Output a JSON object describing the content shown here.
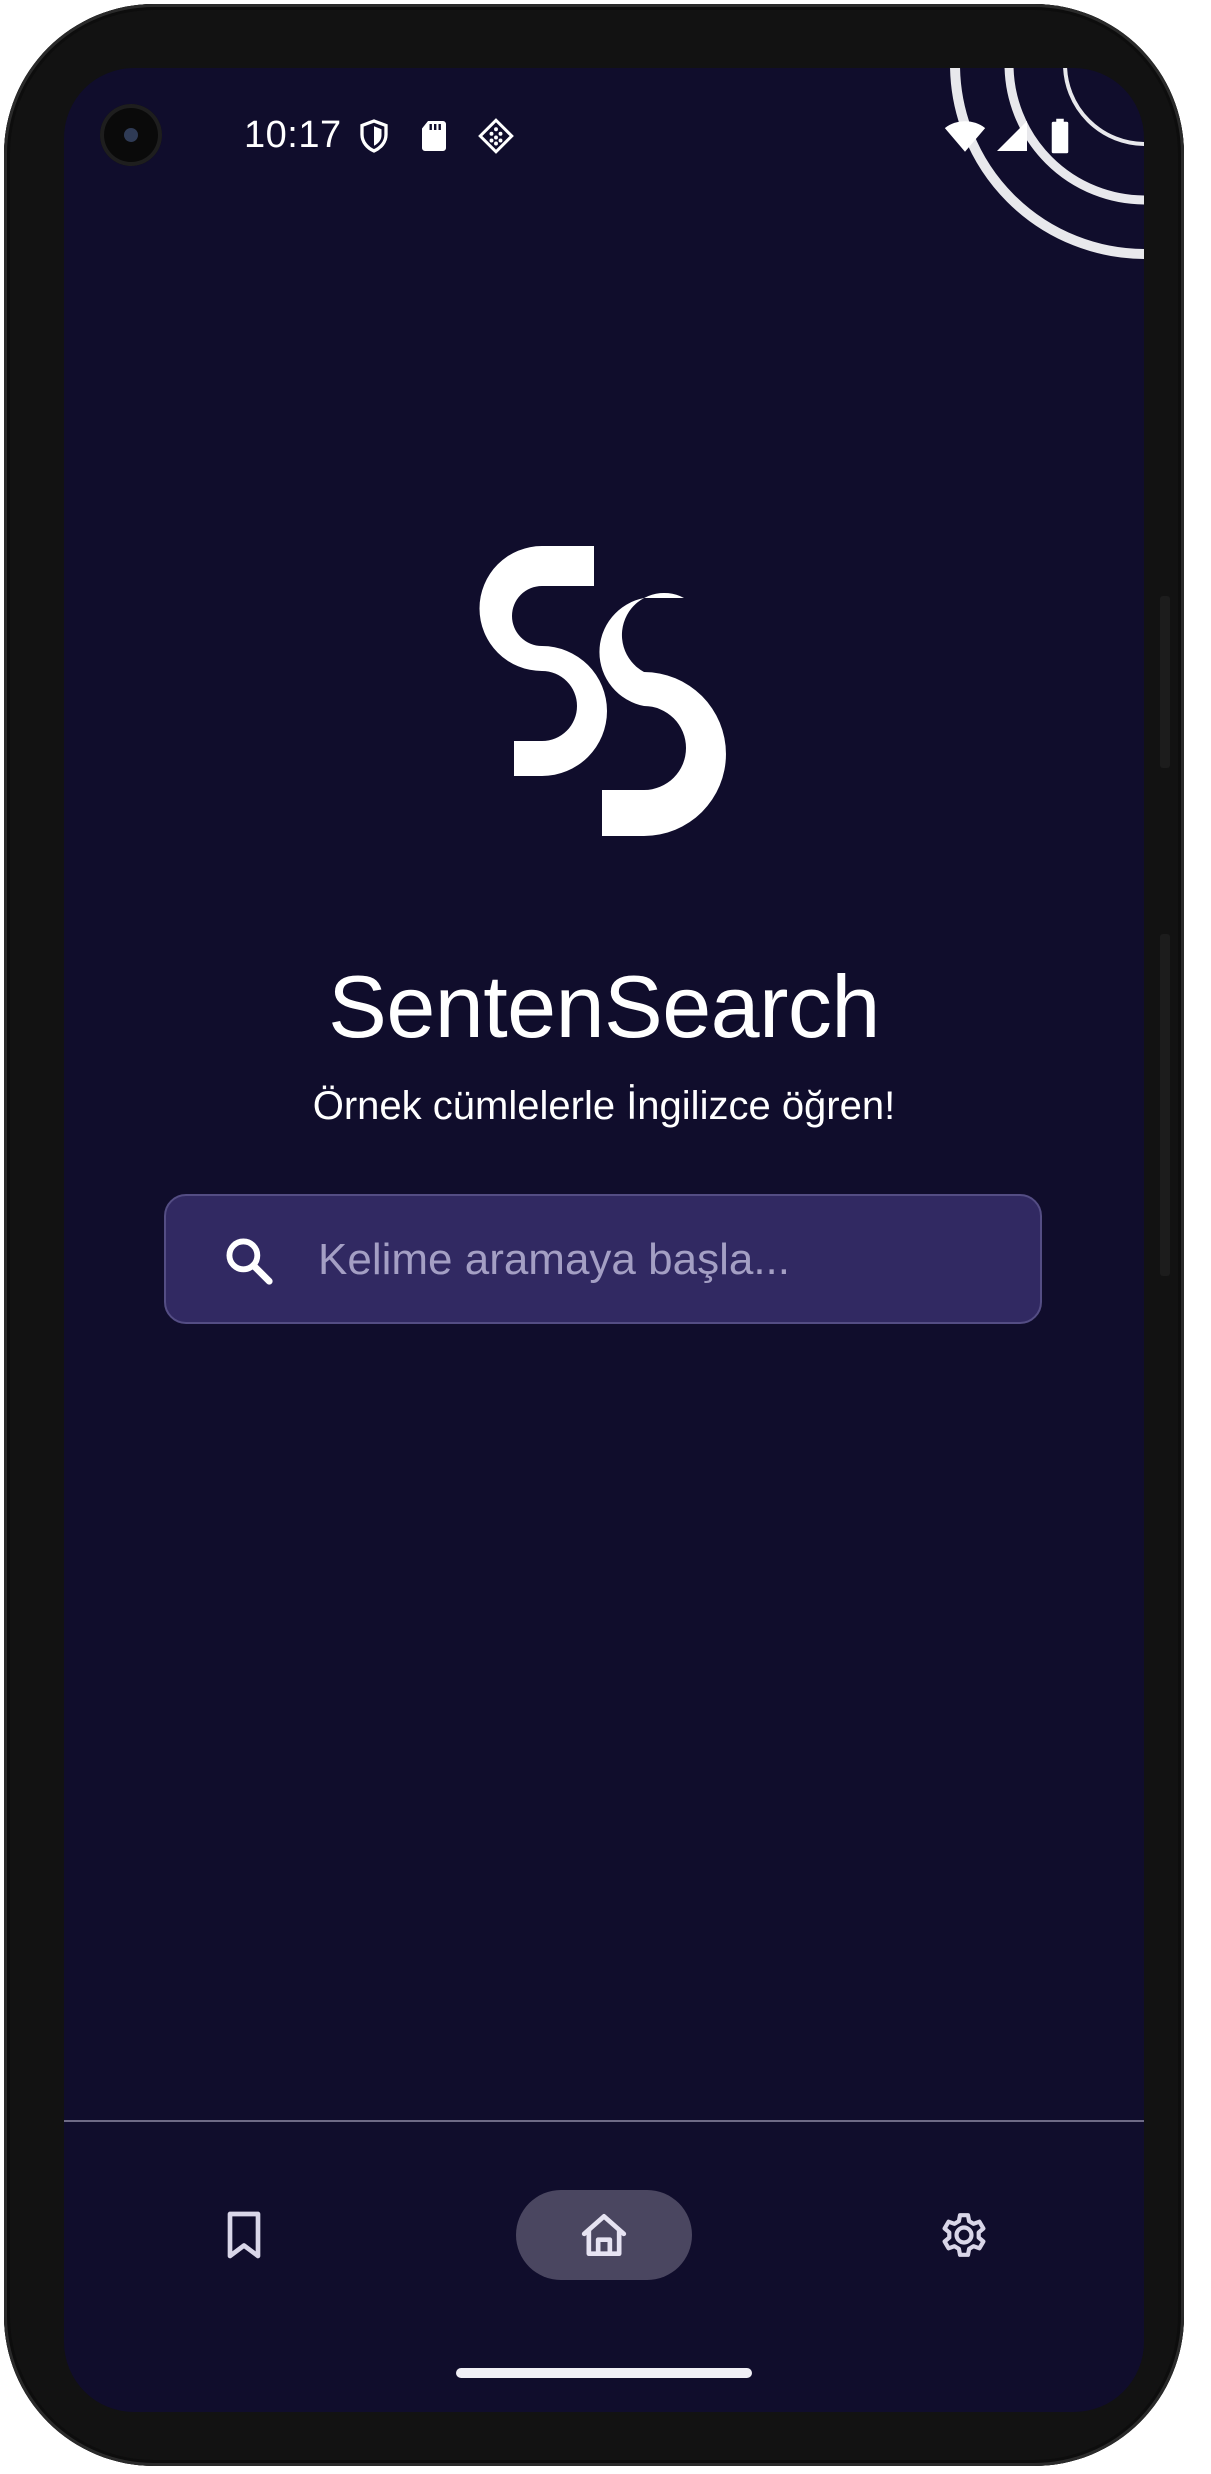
{
  "status_bar": {
    "time": "10:17",
    "left_icons": [
      "shield-icon",
      "sd-card-icon",
      "diamond-grid-icon"
    ],
    "right_icons": [
      "wifi-icon",
      "cell-signal-icon",
      "battery-icon"
    ]
  },
  "app": {
    "title": "SentenSearch",
    "subtitle": "Örnek cümlelerle İngilizce öğren!",
    "logo_icon": "ss-logo-icon"
  },
  "search": {
    "placeholder": "Kelime aramaya başla...",
    "value": ""
  },
  "bottom_nav": {
    "items": [
      {
        "name": "bookmarks",
        "icon": "bookmark-icon",
        "active": false
      },
      {
        "name": "home",
        "icon": "home-icon",
        "active": true
      },
      {
        "name": "settings",
        "icon": "gear-icon",
        "active": false
      }
    ]
  },
  "colors": {
    "background": "#100d2c",
    "search_bg": "#312962",
    "search_border": "#544d84",
    "placeholder": "#a49fc4",
    "nav_active_pill": "#4a4660",
    "text": "#ffffff"
  }
}
